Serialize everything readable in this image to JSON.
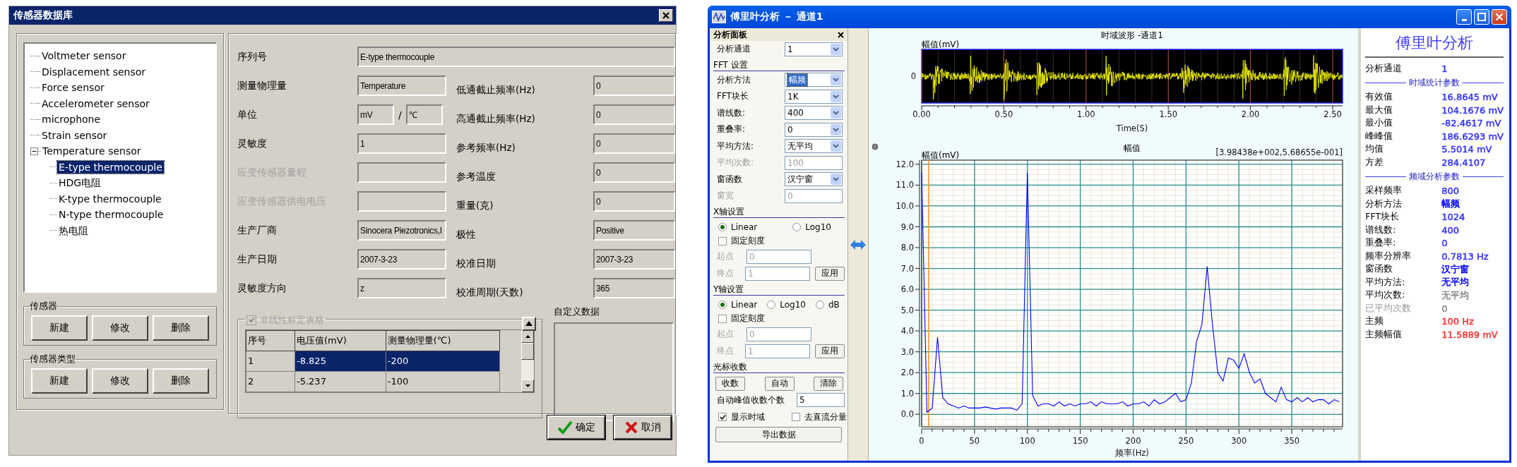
{
  "sensor_db": {
    "title": "传感器数据库",
    "tree": [
      {
        "label": "Voltmeter sensor",
        "selected": false
      },
      {
        "label": "Displacement sensor",
        "selected": false
      },
      {
        "label": "Force sensor",
        "selected": false
      },
      {
        "label": "Accelerometer sensor",
        "selected": false
      },
      {
        "label": "microphone",
        "selected": false
      },
      {
        "label": "Strain sensor",
        "selected": false
      },
      {
        "label": "Temperature sensor",
        "selected": false,
        "expanded": true,
        "children": [
          {
            "label": "E-type thermocouple",
            "selected": true
          },
          {
            "label": "HDG电阻",
            "selected": false
          },
          {
            "label": "K-type thermocouple",
            "selected": false
          },
          {
            "label": "N-type thermocouple",
            "selected": false
          },
          {
            "label": "热电阻",
            "selected": false
          }
        ]
      }
    ],
    "groups": [
      {
        "title": "传感器",
        "buttons": [
          "新建",
          "修改",
          "删除"
        ]
      },
      {
        "title": "传感器类型",
        "buttons": [
          "新建",
          "修改",
          "删除"
        ]
      }
    ],
    "serial": {
      "label": "序列号",
      "value": "E-type thermocouple"
    },
    "rows": [
      {
        "left": {
          "label": "测量物理量",
          "value": "Temperature",
          "disabled": false
        },
        "right": {
          "label": "低通截止频率(Hz)",
          "value": "0"
        }
      },
      {
        "left": {
          "label": "单位",
          "kind": "unit",
          "value": "mV",
          "separator": "/",
          "value2": "℃",
          "disabled": false
        },
        "right": {
          "label": "高通截止频率(Hz)",
          "value": "0"
        }
      },
      {
        "left": {
          "label": "灵敏度",
          "value": "1",
          "disabled": false
        },
        "right": {
          "label": "参考频率(Hz)",
          "value": "0"
        }
      },
      {
        "left": {
          "label": "应变传感器量程",
          "disabled": true
        },
        "right": {
          "label": "参考温度",
          "value": "0"
        }
      },
      {
        "left": {
          "label": "应变传感器供电电压",
          "disabled": true
        },
        "right": {
          "label": "重量(克)",
          "value": "0"
        }
      },
      {
        "left": {
          "label": "生产厂商",
          "value": "Sinocera Piezotronics,I",
          "disabled": false
        },
        "right": {
          "label": "极性",
          "value": "Positive"
        }
      },
      {
        "left": {
          "label": "生产日期",
          "value": "2007-3-23",
          "disabled": false
        },
        "right": {
          "label": "校准日期",
          "value": "2007-3-23"
        }
      },
      {
        "left": {
          "label": "灵敏度方向",
          "value": "z",
          "disabled": false
        },
        "right": {
          "label": "校准周期(天数)",
          "value": "365"
        }
      }
    ],
    "calibration": {
      "label": "非线性标定表格",
      "checked": true,
      "disabled": true,
      "columns": [
        "序号",
        "电压值(mV)",
        "测量物理量(℃)"
      ],
      "rows": [
        {
          "cells": [
            "1",
            "-8.825",
            "-200"
          ],
          "selected": true
        },
        {
          "cells": [
            "2",
            "-5.237",
            "-100"
          ],
          "selected": false
        }
      ]
    },
    "custom_data": {
      "label": "自定义数据"
    },
    "buttons": [
      {
        "label": "确定",
        "kind": "ok"
      },
      {
        "label": "取消",
        "kind": "cancel"
      }
    ]
  },
  "fft_window": {
    "title": "傅里叶分析 － 通道1",
    "panel": {
      "title": "分析面板",
      "channel": {
        "label": "分析通道",
        "value": "1"
      },
      "fft_heading": "FFT 设置",
      "fft_rows": [
        {
          "label": "分析方法",
          "value": "幅频",
          "kind": "select",
          "disabled": false,
          "focused": true
        },
        {
          "label": "FFT块长",
          "value": "1K",
          "kind": "select",
          "disabled": false,
          "focused": false
        },
        {
          "label": "谱线数:",
          "value": "400",
          "kind": "select",
          "disabled": false,
          "focused": false
        },
        {
          "label": "重叠率:",
          "value": "0",
          "kind": "select",
          "disabled": false,
          "focused": false
        },
        {
          "label": "平均方法:",
          "value": "无平均",
          "kind": "select",
          "disabled": false,
          "focused": false
        },
        {
          "label": "平均次数:",
          "value": "100",
          "kind": "input",
          "disabled": true,
          "focused": false
        },
        {
          "label": "窗函数",
          "value": "汉宁窗",
          "kind": "select",
          "disabled": false,
          "focused": false
        },
        {
          "label": "窗宽",
          "value": "0",
          "kind": "input",
          "disabled": true,
          "focused": false
        }
      ],
      "axes": [
        {
          "heading": "X轴设置",
          "scales": [
            {
              "label": "Linear",
              "selected": true
            },
            {
              "label": "Log10",
              "selected": false
            }
          ],
          "fixed": {
            "label": "固定刻度",
            "checked": false
          },
          "start": {
            "label": "起点",
            "value": "0",
            "disabled": true
          },
          "end": {
            "label": "终点",
            "value": "1",
            "disabled": true
          },
          "apply": "应用"
        },
        {
          "heading": "Y轴设置",
          "scales": [
            {
              "label": "Linear",
              "selected": true
            },
            {
              "label": "Log10",
              "selected": false
            },
            {
              "label": "dB",
              "selected": false
            }
          ],
          "fixed": {
            "label": "固定刻度",
            "checked": false
          },
          "start": {
            "label": "起点",
            "value": "0",
            "disabled": true
          },
          "end": {
            "label": "终点",
            "value": "1",
            "disabled": true
          },
          "apply": "应用"
        }
      ],
      "cursor": {
        "heading": "光标收数",
        "buttons": [
          "收数",
          "自动",
          "清除"
        ],
        "peaks": {
          "label": "自动峰值收数个数",
          "value": "5"
        },
        "options": [
          {
            "label": "显示时域",
            "checked": true
          },
          {
            "label": "去直流分量",
            "checked": false
          }
        ],
        "export": "导出数据"
      }
    },
    "time_chart": {
      "title": "时域波形 -通道1",
      "ylabel": "幅值(mV)",
      "yticks": [
        "0"
      ],
      "xticks": [
        "0.00",
        "0.50",
        "1.00",
        "1.50",
        "2.00",
        "2.50"
      ],
      "xlabel": "Time(S)"
    },
    "spectrum": {
      "cursor_readout": "[3.98438e+002,5.68655e-001]",
      "chart_data": {
        "type": "line",
        "title": "幅值",
        "xlabel": "频率(Hz)",
        "ylabel": "幅值(mV)",
        "xlim": [
          0,
          398
        ],
        "ylim": [
          -0.6,
          12.2
        ],
        "xticks": [
          0,
          50,
          100,
          150,
          200,
          250,
          300,
          350
        ],
        "yticks": [
          {
            "value": 0,
            "label": "0.0"
          },
          {
            "value": 1,
            "label": "1.0"
          },
          {
            "value": 2,
            "label": "2.0"
          },
          {
            "value": 3,
            "label": "3.0"
          },
          {
            "value": 4,
            "label": "4.0"
          },
          {
            "value": 5,
            "label": "5.0"
          },
          {
            "value": 6,
            "label": "6.0"
          },
          {
            "value": 7,
            "label": "7.0"
          },
          {
            "value": 8,
            "label": "8.0"
          },
          {
            "value": 9,
            "label": "9.0"
          },
          {
            "value": 10,
            "label": "10.0"
          },
          {
            "value": 11,
            "label": "11.0"
          },
          {
            "value": 12,
            "label": "12.0"
          }
        ],
        "x": [
          0,
          5,
          10,
          15,
          20,
          25,
          30,
          35,
          40,
          45,
          50,
          55,
          60,
          65,
          70,
          75,
          80,
          85,
          90,
          95,
          100,
          105,
          110,
          115,
          120,
          125,
          130,
          135,
          140,
          145,
          150,
          155,
          160,
          165,
          170,
          175,
          180,
          185,
          190,
          195,
          200,
          205,
          210,
          215,
          220,
          225,
          230,
          235,
          240,
          245,
          250,
          255,
          260,
          265,
          270,
          275,
          280,
          285,
          290,
          295,
          300,
          305,
          310,
          315,
          320,
          325,
          330,
          335,
          340,
          345,
          350,
          355,
          360,
          365,
          370,
          375,
          380,
          385,
          390,
          395
        ],
        "series": [
          {
            "color": "#0000ff",
            "values": [
              11.6,
              0.1,
              0.3,
              3.7,
              0.8,
              0.5,
              0.4,
              0.3,
              0.4,
              0.3,
              0.3,
              0.3,
              0.35,
              0.3,
              0.25,
              0.3,
              0.3,
              0.3,
              0.2,
              0.5,
              11.6,
              0.9,
              0.4,
              0.5,
              0.5,
              0.4,
              0.6,
              0.4,
              0.5,
              0.4,
              0.5,
              0.5,
              0.6,
              0.4,
              0.6,
              0.5,
              0.5,
              0.5,
              0.6,
              0.4,
              0.5,
              0.5,
              0.6,
              0.4,
              0.7,
              0.5,
              0.6,
              0.8,
              1.0,
              0.6,
              0.7,
              1.5,
              3.5,
              4.3,
              7.1,
              4.3,
              2.0,
              1.6,
              2.7,
              2.6,
              2.2,
              2.9,
              2.0,
              1.5,
              1.7,
              1.0,
              0.8,
              0.6,
              1.3,
              0.7,
              0.6,
              0.8,
              0.6,
              0.8,
              0.6,
              0.7,
              0.7,
              0.5,
              0.7,
              0.6
            ]
          }
        ],
        "ref_lines": [
          {
            "axis": "x",
            "value": 6.6,
            "color": "#ff8c1a"
          }
        ],
        "grid": true
      }
    },
    "stats": {
      "title": "傅里叶分析",
      "rows": [
        {
          "kind": "row",
          "label": "分析通道",
          "value": "1",
          "color": "#3333ff",
          "disabled": false
        },
        {
          "kind": "section",
          "label": "时域统计参数"
        },
        {
          "kind": "row",
          "label": "有效值",
          "value": "16.8645 mV",
          "color": "#3333ff",
          "disabled": false
        },
        {
          "kind": "row",
          "label": "最大值",
          "value": "104.1676 mV",
          "color": "#3333ff",
          "disabled": false
        },
        {
          "kind": "row",
          "label": "最小值",
          "value": "-82.4617 mV",
          "color": "#3333ff",
          "disabled": false
        },
        {
          "kind": "row",
          "label": "峰峰值",
          "value": "186.6293 mV",
          "color": "#3333ff",
          "disabled": false
        },
        {
          "kind": "row",
          "label": "均值",
          "value": "5.5014 mV",
          "color": "#3333ff",
          "disabled": false
        },
        {
          "kind": "row",
          "label": "方差",
          "value": "284.4107",
          "color": "#3333ff",
          "disabled": false
        },
        {
          "kind": "section",
          "label": "频域分析参数"
        },
        {
          "kind": "row",
          "label": "采样频率",
          "value": "800",
          "color": "#3333ff",
          "disabled": false
        },
        {
          "kind": "row",
          "label": "分析方法",
          "value": "幅频",
          "color": "#0000ff",
          "disabled": false
        },
        {
          "kind": "row",
          "label": "FFT块长",
          "value": "1024",
          "color": "#3333ff",
          "disabled": false
        },
        {
          "kind": "row",
          "label": "谱线数:",
          "value": "400",
          "color": "#3333ff",
          "disabled": false
        },
        {
          "kind": "row",
          "label": "重叠率:",
          "value": "0",
          "color": "#3333ff",
          "disabled": false
        },
        {
          "kind": "row",
          "label": "频率分辨率",
          "value": "0.7813 Hz",
          "color": "#3333ff",
          "disabled": false
        },
        {
          "kind": "row",
          "label": "窗函数",
          "value": "汉宁窗",
          "color": "#0000ff",
          "disabled": false
        },
        {
          "kind": "row",
          "label": "平均方法:",
          "value": "无平均",
          "color": "#0000ff",
          "disabled": false
        },
        {
          "kind": "row",
          "label": "平均次数:",
          "value": "无平均",
          "color": "#888888",
          "disabled": false
        },
        {
          "kind": "row",
          "label": "已平均次数",
          "value": "0",
          "color": "#888888",
          "disabled": true
        },
        {
          "kind": "row",
          "label": "主频",
          "value": "100 Hz",
          "color": "#ff3333",
          "disabled": false
        },
        {
          "kind": "row",
          "label": "主频幅值",
          "value": "11.5889 mV",
          "color": "#ff3333",
          "disabled": false
        }
      ]
    }
  }
}
